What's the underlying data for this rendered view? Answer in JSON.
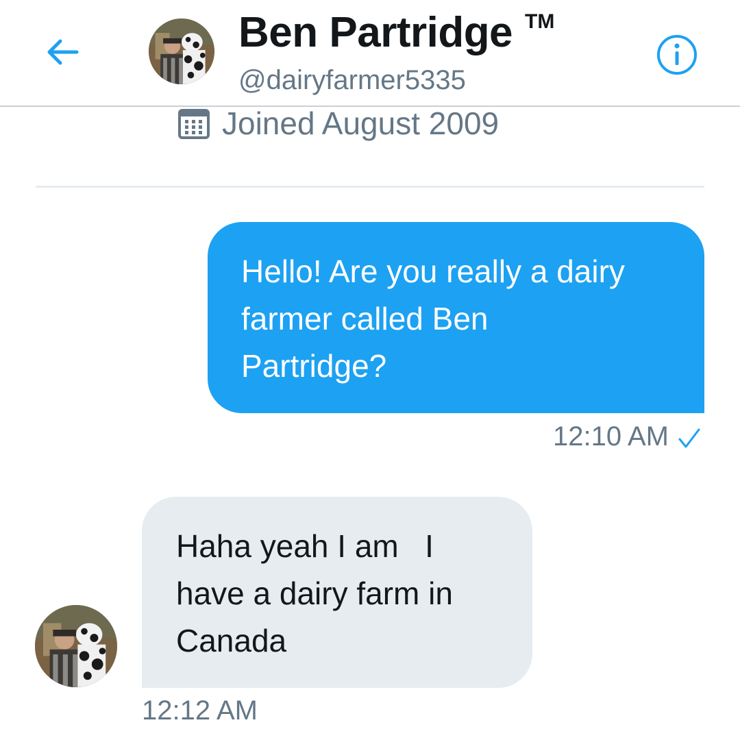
{
  "colors": {
    "accent": "#1da1f2",
    "text_primary": "#14171a",
    "text_secondary": "#657786",
    "bubble_received": "#e6ecf0",
    "divider": "#c9d0d6"
  },
  "header": {
    "back_icon": "arrow-left-icon",
    "avatar_icon": "profile-avatar",
    "display_name": "Ben Partridge",
    "trademark": "TM",
    "handle": "@dairyfarmer5335",
    "info_icon": "info-circle-icon"
  },
  "profile_summary": {
    "calendar_icon": "calendar-icon",
    "joined": "Joined August 2009"
  },
  "messages": [
    {
      "direction": "sent",
      "lines": [
        "Hello! Are you really a dairy",
        "farmer called Ben",
        "Partridge?"
      ],
      "time": "12:10 AM",
      "status_icon": "checkmark-icon"
    },
    {
      "direction": "received",
      "lines": [
        "Haha yeah I am   I",
        "have a dairy farm in",
        "Canada"
      ],
      "time": "12:12 AM",
      "avatar_icon": "profile-avatar"
    }
  ]
}
